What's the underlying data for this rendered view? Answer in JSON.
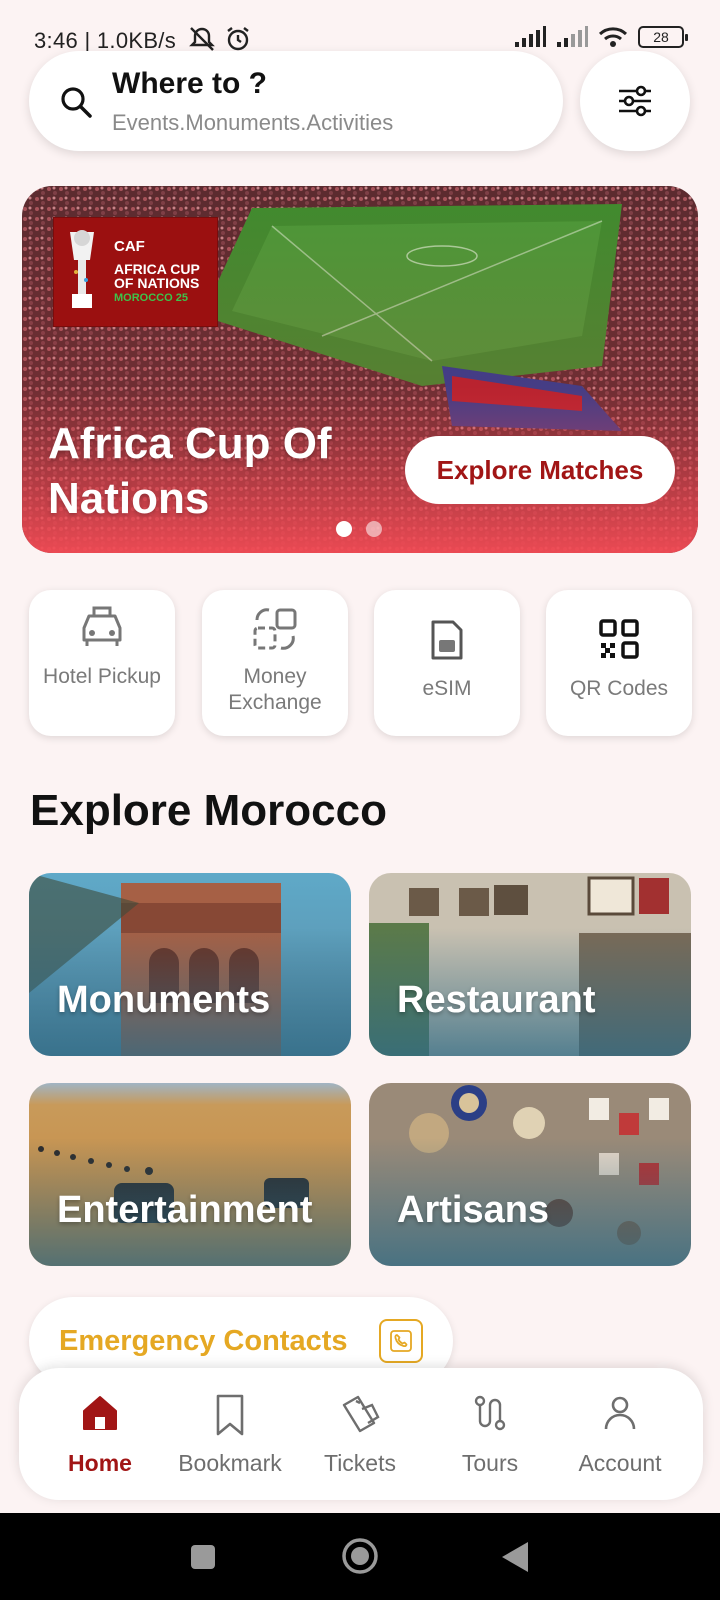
{
  "status": {
    "time": "3:46",
    "net_speed": "1.0KB/s",
    "battery": "28"
  },
  "search": {
    "title": "Where to ?",
    "subtitle": "Events.Monuments.Activities"
  },
  "hero": {
    "logo_line1": "CAF",
    "logo_line2": "AFRICA CUP",
    "logo_line3": "OF NATIONS",
    "logo_line4": "MOROCCO 25",
    "title": "Africa Cup Of Nations",
    "cta": "Explore Matches",
    "slides": 2,
    "active_slide": 1
  },
  "quick_actions": [
    {
      "label": "Hotel Pickup",
      "icon": "car-icon"
    },
    {
      "label": "Money Exchange",
      "icon": "exchange-icon"
    },
    {
      "label": "eSIM",
      "icon": "sim-card-icon"
    },
    {
      "label": "QR Codes",
      "icon": "qr-code-icon"
    }
  ],
  "explore": {
    "title": "Explore Morocco",
    "tiles": [
      {
        "label": "Monuments"
      },
      {
        "label": "Restaurant"
      },
      {
        "label": "Entertainment"
      },
      {
        "label": "Artisans"
      }
    ]
  },
  "emergency": {
    "label": "Emergency Contacts"
  },
  "nav": {
    "items": [
      {
        "label": "Home",
        "icon": "home-icon",
        "active": true
      },
      {
        "label": "Bookmark",
        "icon": "bookmark-icon",
        "active": false
      },
      {
        "label": "Tickets",
        "icon": "tickets-icon",
        "active": false
      },
      {
        "label": "Tours",
        "icon": "route-icon",
        "active": false
      },
      {
        "label": "Account",
        "icon": "user-icon",
        "active": false
      }
    ]
  },
  "colors": {
    "brand_red": "#a11515",
    "emergency_yellow": "#e5a823",
    "background": "#fcf3f3"
  }
}
